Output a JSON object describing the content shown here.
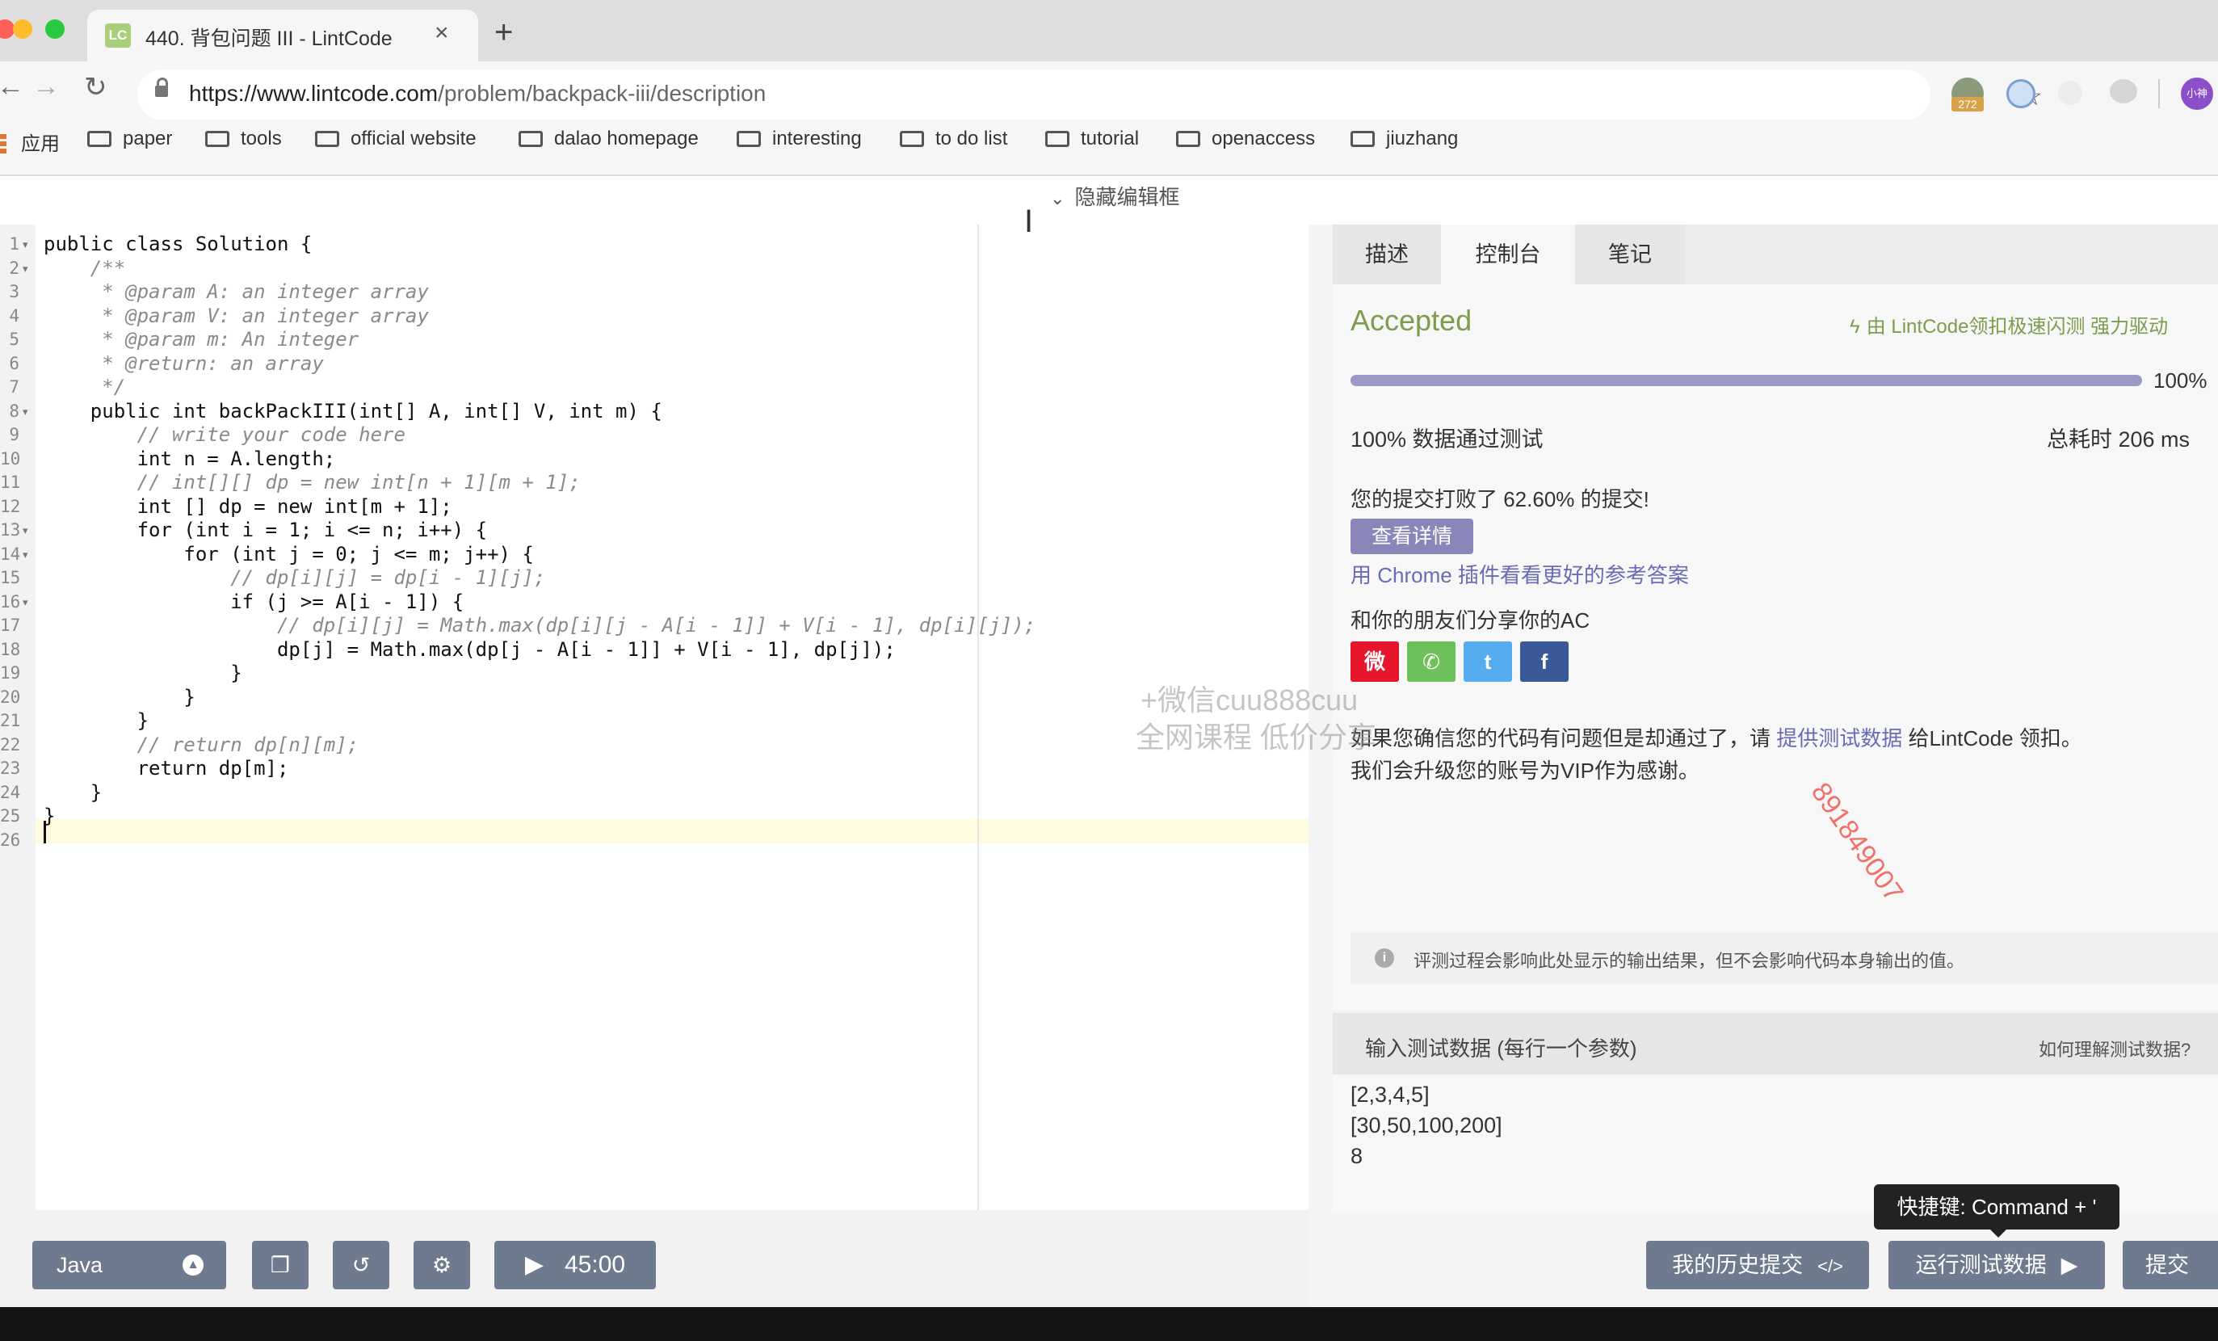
{
  "browser": {
    "tab": {
      "favicon": "LC",
      "title": "440. 背包问题 III - LintCode",
      "close": "×"
    },
    "new_tab": "+",
    "url": {
      "host": "https://www.lintcode.com",
      "path": "/problem/backpack-iii/description"
    },
    "extension_badge": "272",
    "profile": "小神",
    "bookmarks": [
      "应用",
      "paper",
      "tools",
      "official website",
      "dalao homepage",
      "interesting",
      "to do list",
      "tutorial",
      "openaccess",
      "jiuzhang"
    ]
  },
  "editor": {
    "hide_label": "隐藏编辑框",
    "line_numbers": [
      "1",
      "2",
      "3",
      "4",
      "5",
      "6",
      "7",
      "8",
      "9",
      "10",
      "11",
      "12",
      "13",
      "14",
      "15",
      "16",
      "17",
      "18",
      "19",
      "20",
      "21",
      "22",
      "23",
      "24",
      "25",
      "26"
    ],
    "lines": [
      "public class Solution {",
      "    /**",
      "     * @param A: an integer array",
      "     * @param V: an integer array",
      "     * @param m: An integer",
      "     * @return: an array",
      "     */",
      "    public int backPackIII(int[] A, int[] V, int m) {",
      "        // write your code here",
      "        int n = A.length;",
      "        // int[][] dp = new int[n + 1][m + 1];",
      "        int [] dp = new int[m + 1];",
      "        for (int i = 1; i <= n; i++) {",
      "            for (int j = 0; j <= m; j++) {",
      "                // dp[i][j] = dp[i - 1][j];",
      "                if (j >= A[i - 1]) {",
      "                    // dp[i][j] = Math.max(dp[i][j - A[i - 1]] + V[i - 1], dp[i][j]);",
      "                    dp[j] = Math.max(dp[j - A[i - 1]] + V[i - 1], dp[j]);",
      "                }",
      "            }",
      "        }",
      "        // return dp[n][m];",
      "        return dp[m];",
      "    }",
      "}",
      ""
    ],
    "language": "Java",
    "timer": "45:00"
  },
  "panel": {
    "tabs": [
      "描述",
      "控制台",
      "笔记"
    ],
    "status": "Accepted",
    "engine_note": "由 LintCode领扣极速闪测 强力驱动",
    "progress_pct": 100,
    "progress_label": "100%",
    "tests_passed": "100% 数据通过测试",
    "total_time": "总耗时 206 ms",
    "beat_text": "您的提交打败了 62.60% 的提交!",
    "details_btn": "查看详情",
    "chrome_link": "用 Chrome 插件看看更好的参考答案",
    "share_title": "和你的朋友们分享你的AC",
    "share_icons": [
      "weibo-icon",
      "wechat-icon",
      "twitter-icon",
      "facebook-icon"
    ],
    "feedback_1": "如果您确信您的代码有问题但是却通过了，请 ",
    "feedback_link": "提供测试数据",
    "feedback_2": " 给LintCode 领扣。",
    "feedback_line2": "我们会升级您的账号为VIP作为感谢。",
    "info_note": "评测过程会影响此处显示的输出结果，但不会影响代码本身输出的值。",
    "input_title": "输入测试数据 (每行一个参数)",
    "input_help": "如何理解测试数据?",
    "input_lines": [
      "[2,3,4,5]",
      "[30,50,100,200]",
      "8"
    ],
    "shortcut_tooltip": "快捷键: Command + '",
    "history_btn": "我的历史提交",
    "run_btn": "运行测试数据",
    "submit_btn": "提交"
  },
  "watermark": {
    "line1": "+微信cuu888cuu",
    "line2": "全网课程 低价分享",
    "number": "891849007"
  },
  "colors": {
    "accent": "#7d9c4c",
    "progress": "#9c99c4",
    "link": "#6b6bb5",
    "button": "#6e7a8e",
    "weibo": "#e6162d",
    "wechat": "#6ec05a",
    "twitter": "#55acee",
    "facebook": "#3b5998"
  }
}
